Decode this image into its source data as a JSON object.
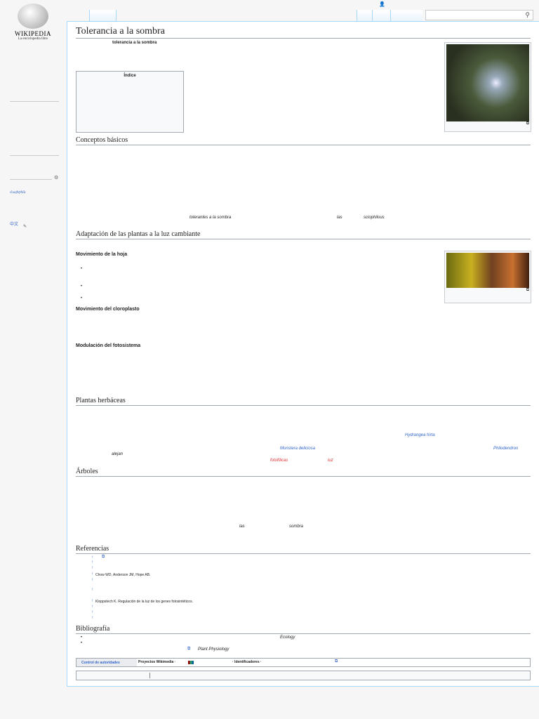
{
  "logo": {
    "wordmark": "WIKIPEDIA",
    "tagline": "La enciclopedia libre"
  },
  "sidebar": {
    "languages": [
      "Հայերեն",
      "中文"
    ]
  },
  "search": {
    "placeholder": "",
    "icon": "search-icon"
  },
  "article": {
    "title": "Tolerancia a la sombra",
    "lead_bold": "tolerancia a la sombra",
    "toc_title": "Índice",
    "sections": {
      "conceptos": "Conceptos básicos",
      "adaptacion": "Adaptación de las plantas a la luz cambiante",
      "hoja": "Movimiento de la hoja",
      "cloroplasto": "Movimiento del cloroplasto",
      "fotosistema": "Modulación del fotosistema",
      "herbaceas": "Plantas herbáceas",
      "arboles": "Árboles",
      "referencias": "Referencias",
      "bibliografia": "Bibliografía"
    },
    "conceptos_words": [
      "tolerantes a la sombra",
      "las",
      "sciophilous"
    ],
    "herbaceas_words": [
      "Hydrangea hirta",
      "Monstera deliciosa",
      "Philodendron",
      "alejan",
      "fotofílicas",
      "luz"
    ],
    "arboles_words": [
      "las",
      "sombra"
    ],
    "references": [
      "Chow WD, Anderson JM, Hope AB.",
      "Kloppstech K. Regulación de la luz de los genes fotosintéticos."
    ],
    "ref_marker": "↑",
    "bibliography": [
      "Ecology",
      "Plant Physiology"
    ],
    "authority": {
      "label": "Control de autoridades",
      "projects": "Proyectos Wikimedia ·",
      "ids": "· Identificadores ·"
    }
  }
}
